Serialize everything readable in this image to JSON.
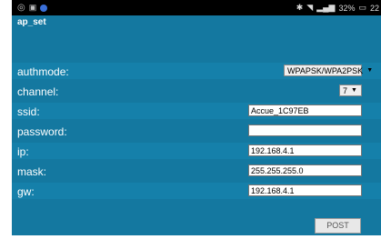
{
  "status_bar": {
    "battery_text": "32%",
    "time_text": "22"
  },
  "app": {
    "title": "ap_set",
    "fields": [
      {
        "label": "authmode:",
        "kind": "select",
        "value": "WPAPSK/WPA2PSK"
      },
      {
        "label": "channel:",
        "kind": "select",
        "value": "7"
      },
      {
        "label": "ssid:",
        "kind": "text",
        "value": "Accue_1C97EB"
      },
      {
        "label": "password:",
        "kind": "text",
        "value": ""
      },
      {
        "label": "ip:",
        "kind": "text",
        "value": "192.168.4.1"
      },
      {
        "label": "mask:",
        "kind": "text",
        "value": "255.255.255.0"
      },
      {
        "label": "gw:",
        "kind": "text",
        "value": "192.168.4.1"
      }
    ],
    "post_label": "POST"
  },
  "colors": {
    "app_background": "#1478a0",
    "status_bar": "#000000"
  }
}
